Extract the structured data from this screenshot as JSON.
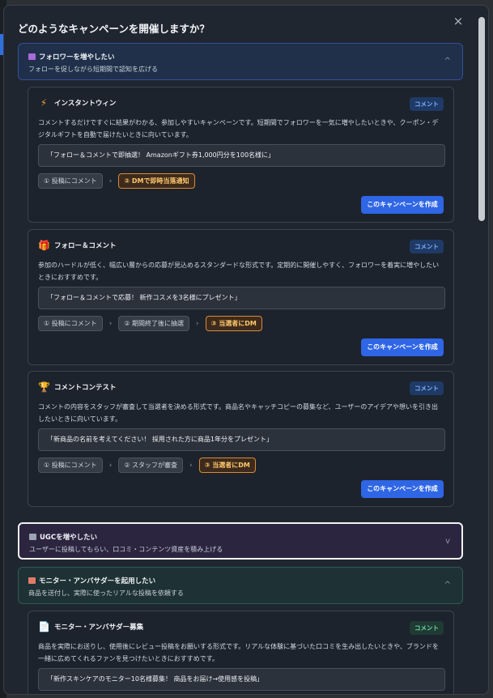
{
  "modal": {
    "title": "どのようなキャンペーンを開催しますか？",
    "close_icon": "×"
  },
  "sections": {
    "follow": {
      "title": "フォロワーを増やしたい",
      "desc": "フォローを促しながら短期間で認知を広げる",
      "icon": "people-icon",
      "chevron": "^"
    },
    "ugc": {
      "title": "UGCを増やしたい",
      "desc": "ユーザーに投稿してもらい、口コミ・コンテンツ資産を積み上げる",
      "icon": "camera-icon",
      "chevron": "v"
    },
    "monitor": {
      "title": "モニター・アンバサダーを起用したい",
      "desc": "商品を送付し、実際に使ったリアルな投稿を依頼する",
      "icon": "document-icon",
      "chevron": "^"
    }
  },
  "cards": [
    {
      "icon": "lightning-icon",
      "icon_glyph": "⚡",
      "title": "インスタントウィン",
      "badge": "コメント",
      "desc": "コメントするだけですぐに結果がわかる、参加しやすいキャンペーンです。短期間でフォロワーを一気に増やしたいときや、クーポン・デジタルギフトを自動で届けたいときに向いています。",
      "example": "「フォロー＆コメントで即抽選！ Amazonギフト券1,000円分を100名様に」",
      "steps": [
        "① 投稿にコメント",
        "② DMで即時当落通知"
      ],
      "button": "このキャンペーンを作成"
    },
    {
      "icon": "gift-icon",
      "icon_glyph": "🎁",
      "title": "フォロー＆コメント",
      "badge": "コメント",
      "desc": "参加のハードルが低く、幅広い層からの応募が見込めるスタンダードな形式です。定期的に開催しやすく、フォロワーを着実に増やしたいときにおすすめです。",
      "example": "「フォロー＆コメントで応募！ 新作コスメを3名様にプレゼント」",
      "steps": [
        "① 投稿にコメント",
        "② 期間終了後に抽選",
        "③ 当選者にDM"
      ],
      "button": "このキャンペーンを作成"
    },
    {
      "icon": "trophy-icon",
      "icon_glyph": "🏆",
      "title": "コメントコンテスト",
      "badge": "コメント",
      "desc": "コメントの内容をスタッフが審査して当選者を決める形式です。商品名やキャッチコピーの募集など、ユーザーのアイデアや想いを引き出したいときに向いています。",
      "example": "「新商品の名前を考えてください！ 採用された方に商品1年分をプレゼント」",
      "steps": [
        "① 投稿にコメント",
        "② スタッフが審査",
        "③ 当選者にDM"
      ],
      "button": "このキャンペーンを作成"
    },
    {
      "icon": "document-icon",
      "icon_glyph": "📄",
      "title": "モニター・アンバサダー募集",
      "badge": "コメント",
      "desc": "商品を実際にお送りし、使用後にレビュー投稿をお願いする形式です。リアルな体験に基づいた口コミを生み出したいときや、ブランドを一緒に広めてくれるファンを見つけたいときにおすすめです。",
      "example": "「新作スキンケアのモニター10名様募集！ 商品をお届け→使用感を投稿」"
    }
  ],
  "colors": {
    "accent": "#2f66e6",
    "highlight_step": "#ffc86b",
    "badge_blue": "#7fb0ff",
    "badge_green": "#6fd8a8"
  }
}
